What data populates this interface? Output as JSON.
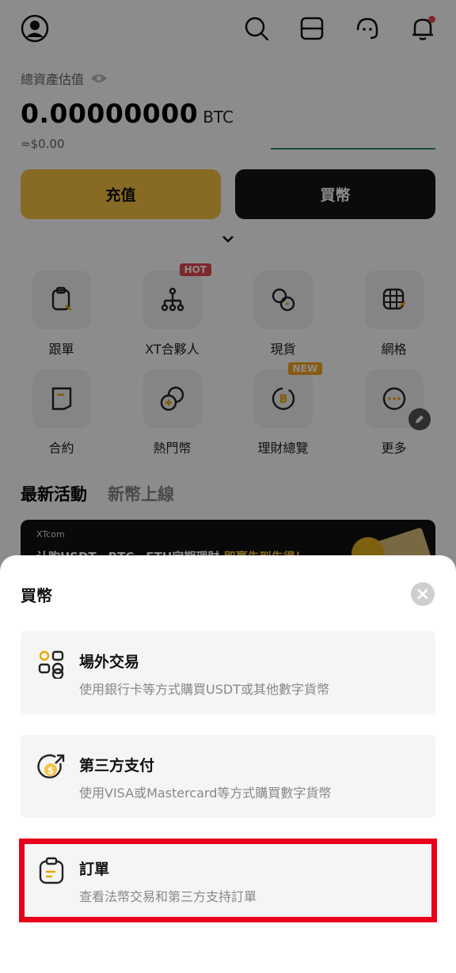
{
  "header": {
    "icons": [
      "avatar-icon",
      "search-icon",
      "scan-icon",
      "support-icon",
      "bell-icon"
    ]
  },
  "assets": {
    "label": "總資產估值",
    "value": "0.00000000",
    "unit": "BTC",
    "fiat": "≈$0.00"
  },
  "actions": {
    "deposit": "充值",
    "buy": "買幣"
  },
  "grid": [
    {
      "label": "跟單",
      "icon": "copy-trade-icon",
      "badge": ""
    },
    {
      "label": "XT合夥人",
      "icon": "partner-icon",
      "badge": "HOT"
    },
    {
      "label": "現貨",
      "icon": "spot-icon",
      "badge": ""
    },
    {
      "label": "網格",
      "icon": "grid-icon",
      "badge": ""
    },
    {
      "label": "合約",
      "icon": "contract-icon",
      "badge": ""
    },
    {
      "label": "熱門幣",
      "icon": "hot-coin-icon",
      "badge": ""
    },
    {
      "label": "理財總覽",
      "icon": "earn-icon",
      "badge": "NEW"
    },
    {
      "label": "更多",
      "icon": "more-icon",
      "badge": ""
    }
  ],
  "tabs": [
    "最新活動",
    "新幣上線"
  ],
  "banner": {
    "logo": "XTcom",
    "text_prefix": "认购USDT、BTC、ETH定期理财",
    "text_highlight": "即赢先到先得！"
  },
  "sheet": {
    "title": "買幣",
    "options": [
      {
        "title": "場外交易",
        "desc": "使用銀行卡等方式購買USDT或其他數字貨幣",
        "icon": "otc-icon"
      },
      {
        "title": "第三方支付",
        "desc": "使用VISA或Mastercard等方式購買數字貨幣",
        "icon": "third-party-pay-icon"
      },
      {
        "title": "訂單",
        "desc": "查看法幣交易和第三方支持訂單",
        "icon": "order-icon"
      }
    ]
  },
  "colors": {
    "accent": "#f6c343",
    "dark": "#151515",
    "highlight": "#e8001b"
  }
}
